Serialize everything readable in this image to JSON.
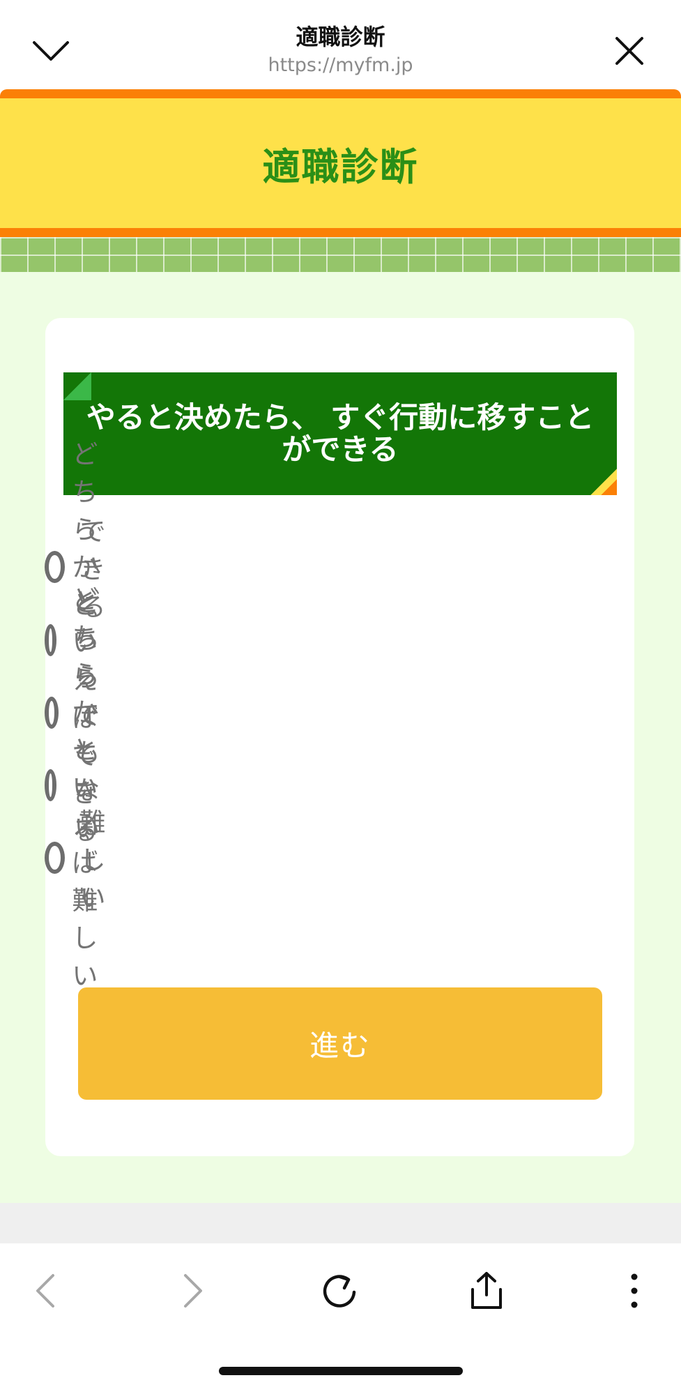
{
  "browser": {
    "title": "適職診断",
    "url": "https://myfm.jp"
  },
  "page": {
    "header_title": "適職診断",
    "question": "やると決めたら、 すぐ行動に移すことができる",
    "options": [
      {
        "label": "できる"
      },
      {
        "label": "どちらかといえばできる"
      },
      {
        "label": "どちらでもない"
      },
      {
        "label": "どちらかといえば難しい"
      },
      {
        "label": "難しい"
      }
    ],
    "next_label": "進む"
  },
  "colors": {
    "banner_yellow": "#fee14a",
    "banner_orange": "#fb8006",
    "title_green": "#2a8f17",
    "question_green": "#137607",
    "button_yellow": "#f6bd36",
    "background_green": "#eefde3"
  },
  "icons": {
    "top_left": "chevron-down-icon",
    "top_right": "close-icon",
    "toolbar": [
      "back-icon",
      "forward-icon",
      "reload-icon",
      "share-icon",
      "more-icon"
    ]
  }
}
